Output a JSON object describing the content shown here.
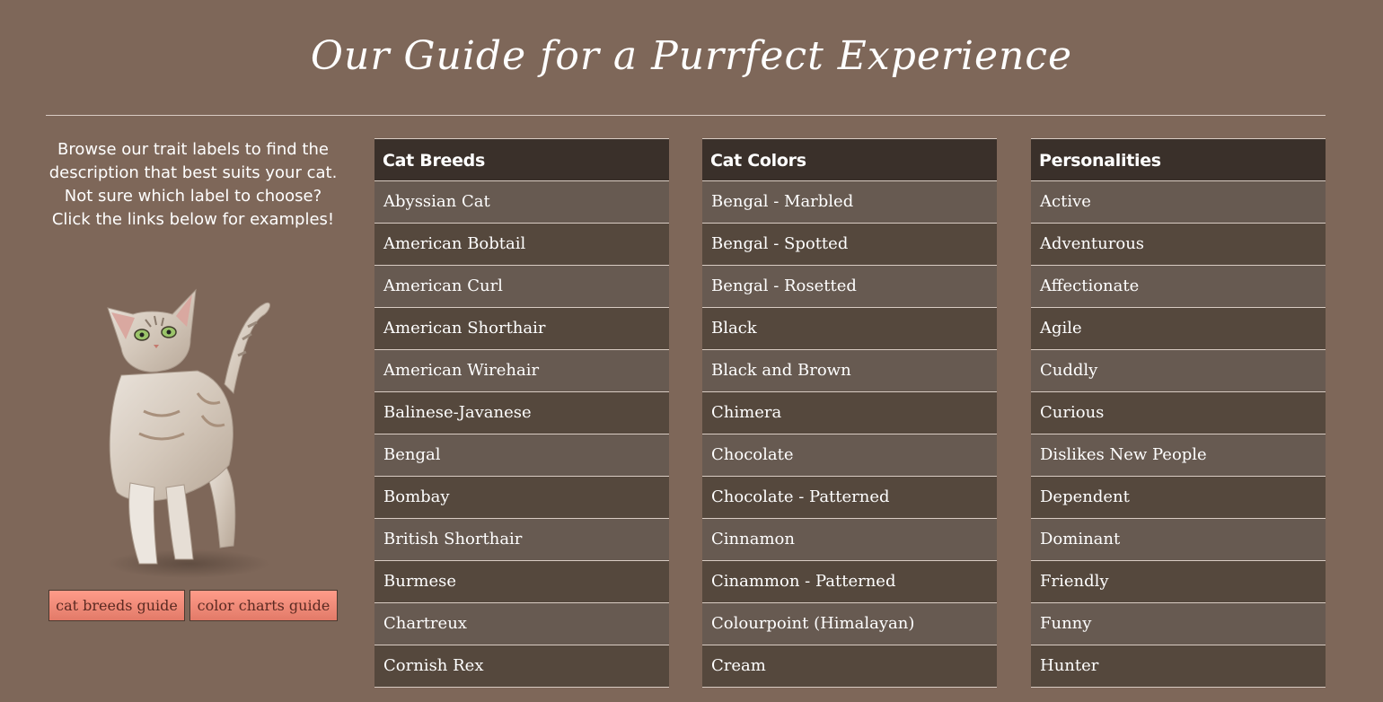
{
  "title": "Our Guide for a Purrfect Experience",
  "intro": {
    "line1": "Browse our trait labels to find the",
    "line2": "description that best suits your cat.",
    "line3": "Not sure which label to choose?",
    "line4": "Click the links below for examples!"
  },
  "buttons": {
    "breeds_guide": "cat breeds guide",
    "colors_guide": "color charts guide"
  },
  "columns": {
    "breeds": {
      "header": "Cat Breeds",
      "items": [
        "Abyssian Cat",
        "American Bobtail",
        "American Curl",
        "American Shorthair",
        "American Wirehair",
        "Balinese-Javanese",
        "Bengal",
        "Bombay",
        "British Shorthair",
        "Burmese",
        "Chartreux",
        "Cornish Rex"
      ]
    },
    "colors": {
      "header": "Cat Colors",
      "items": [
        "Bengal - Marbled",
        "Bengal - Spotted",
        "Bengal - Rosetted",
        "Black",
        "Black and Brown",
        "Chimera",
        "Chocolate",
        "Chocolate - Patterned",
        "Cinnamon",
        "Cinammon - Patterned",
        "Colourpoint (Himalayan)",
        "Cream"
      ]
    },
    "personalities": {
      "header": "Personalities",
      "items": [
        "Active",
        "Adventurous",
        "Affectionate",
        "Agile",
        "Cuddly",
        "Curious",
        "Dislikes New People",
        "Dependent",
        "Dominant",
        "Friendly",
        "Funny",
        "Hunter"
      ]
    }
  },
  "colors": {
    "background": "#7e6759",
    "header_bg": "#3a302a",
    "row_light": "#675a51",
    "row_dark": "#55483d",
    "button_bg": "#f08a78",
    "button_text": "#5b2a22"
  },
  "icons": {
    "cat_photo": "standing-tabby-cat-illustration"
  }
}
